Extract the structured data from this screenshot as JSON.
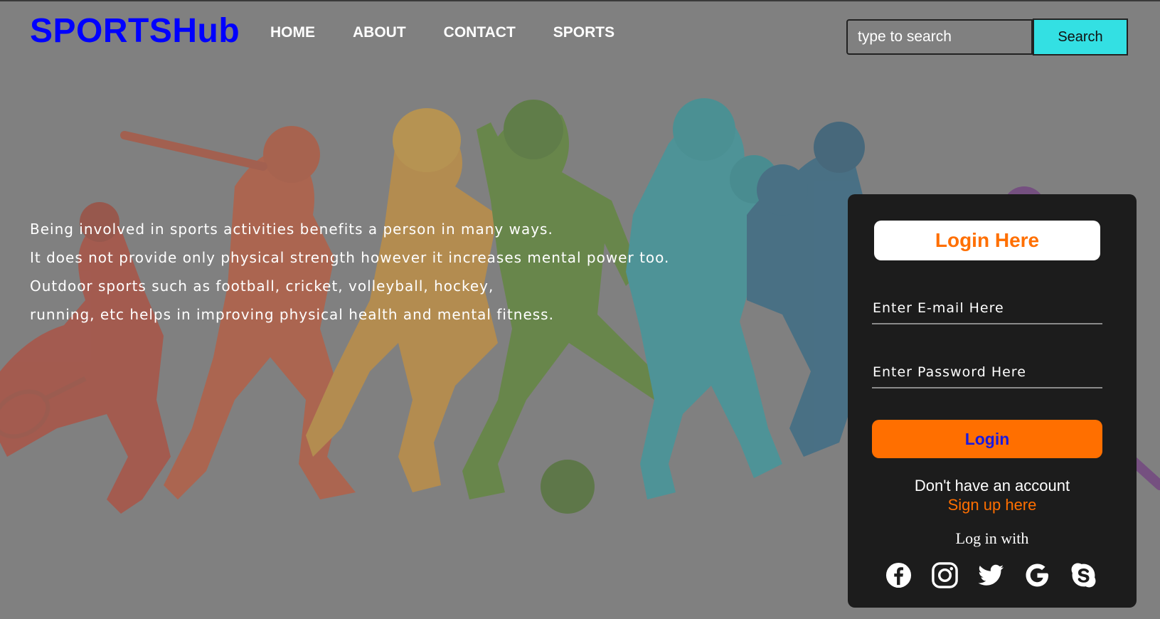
{
  "header": {
    "logo": "SPORTSHub",
    "nav": [
      "HOME",
      "ABOUT",
      "CONTACT",
      "SPORTS"
    ],
    "search_placeholder": "type to search",
    "search_button": "Search"
  },
  "intro": {
    "lines": [
      "Being involved in sports activities benefits a person in many ways.",
      "It does not provide only physical strength however it increases mental power too.",
      "Outdoor sports such as football, cricket, volleyball, hockey,",
      "running, etc helps in improving physical health and mental fitness."
    ]
  },
  "login": {
    "title": "Login Here",
    "email_placeholder": "Enter E-mail Here",
    "password_placeholder": "Enter Password Here",
    "login_button": "Login",
    "no_account": "Don't have an account",
    "signup_link": "Sign up here",
    "login_with": "Log in with",
    "socials": [
      "facebook-icon",
      "instagram-icon",
      "twitter-icon",
      "google-icon",
      "skype-icon"
    ]
  },
  "colors": {
    "logo": "#0000ff",
    "accent": "#ff6f00",
    "search_button": "#33e0e3",
    "card_bg": "#1c1c1c",
    "page_bg": "#808080"
  }
}
